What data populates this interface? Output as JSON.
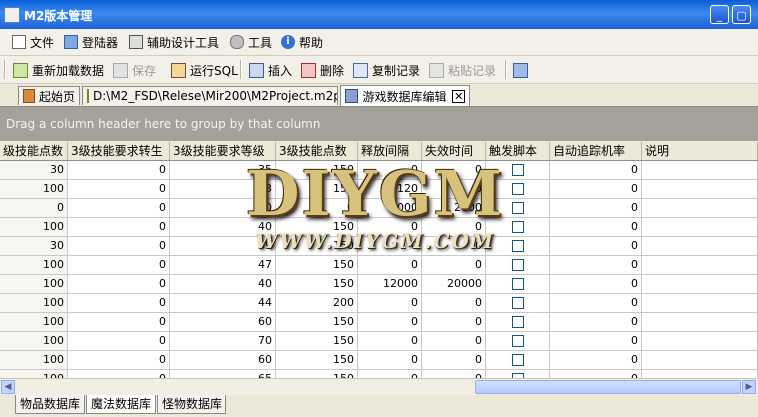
{
  "window": {
    "title": "M2版本管理"
  },
  "menu": {
    "items": [
      "文件",
      "登陆器",
      "辅助设计工具",
      "工具",
      "帮助"
    ]
  },
  "toolbar": {
    "reload": "重新加载数据",
    "save": "保存",
    "run_sql": "运行SQL",
    "insert": "插入",
    "delete": "删除",
    "copy_record": "复制记录",
    "paste_record": "粘贴记录"
  },
  "tabs": [
    {
      "label": "起始页"
    },
    {
      "label": "D:\\M2_FSD\\Relese\\Mir200\\M2Project.m2project"
    },
    {
      "label": "游戏数据库编辑",
      "close": "✕"
    }
  ],
  "group_panel": {
    "text": "Drag a column header here to group by that column"
  },
  "grid": {
    "columns": [
      "级技能点数",
      "3级技能要求转生",
      "3级技能要求等级",
      "3级技能点数",
      "释放间隔",
      "失效时间",
      "触发脚本",
      "自动追踪机率",
      "说明"
    ],
    "rows": [
      [
        "30",
        "0",
        "35",
        "150",
        "0",
        "0",
        "",
        "0",
        ""
      ],
      [
        "100",
        "0",
        "33",
        "150",
        "120",
        "0",
        "",
        "0",
        ""
      ],
      [
        "0",
        "0",
        "0",
        "0",
        "2000",
        "2000",
        "",
        "0",
        ""
      ],
      [
        "100",
        "0",
        "40",
        "150",
        "0",
        "0",
        "",
        "0",
        ""
      ],
      [
        "30",
        "0",
        "39",
        "150",
        "0",
        "0",
        "",
        "0",
        ""
      ],
      [
        "100",
        "0",
        "47",
        "150",
        "0",
        "0",
        "",
        "0",
        ""
      ],
      [
        "100",
        "0",
        "40",
        "150",
        "12000",
        "20000",
        "",
        "0",
        ""
      ],
      [
        "100",
        "0",
        "44",
        "200",
        "0",
        "0",
        "",
        "0",
        ""
      ],
      [
        "100",
        "0",
        "60",
        "150",
        "0",
        "0",
        "",
        "0",
        ""
      ],
      [
        "100",
        "0",
        "70",
        "150",
        "0",
        "0",
        "",
        "0",
        ""
      ],
      [
        "100",
        "0",
        "60",
        "150",
        "0",
        "0",
        "",
        "0",
        ""
      ],
      [
        "100",
        "0",
        "65",
        "150",
        "0",
        "0",
        "",
        "0",
        ""
      ]
    ]
  },
  "bottom_tabs": [
    "物品数据库",
    "魔法数据库",
    "怪物数据库"
  ],
  "watermark": {
    "logo": "DIYGM",
    "url": "WWW.DIYGM.COM"
  },
  "colors": {
    "title_bar": "#0a5fd8",
    "group_panel": "#a4a19a",
    "checkbox_border": "#1c5180"
  },
  "icons": {
    "menu": [
      "file-icon",
      "monitor-icon",
      "design-tool-icon",
      "wrench-icon",
      "info-icon"
    ]
  }
}
